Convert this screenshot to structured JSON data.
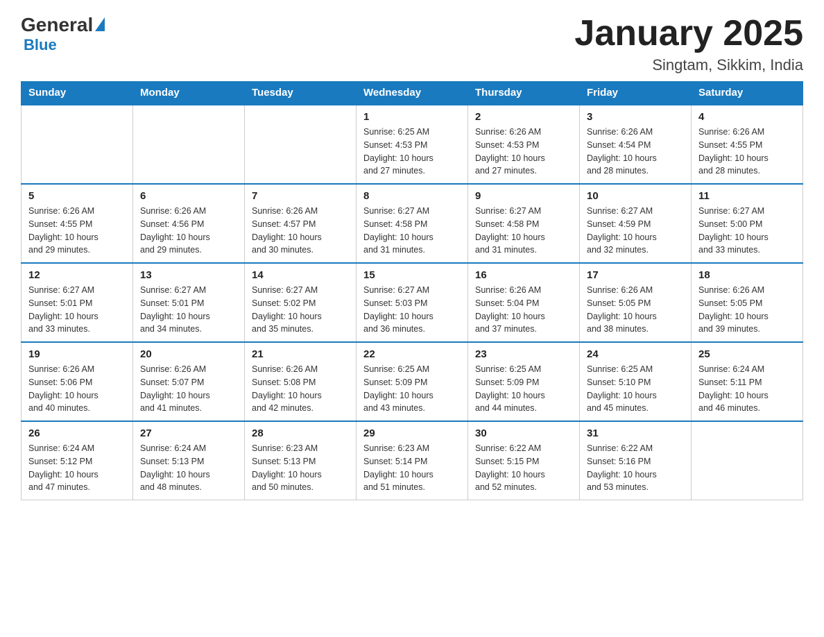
{
  "header": {
    "logo_general": "General",
    "logo_blue": "Blue",
    "month_title": "January 2025",
    "location": "Singtam, Sikkim, India"
  },
  "weekdays": [
    "Sunday",
    "Monday",
    "Tuesday",
    "Wednesday",
    "Thursday",
    "Friday",
    "Saturday"
  ],
  "weeks": [
    [
      {
        "day": "",
        "info": ""
      },
      {
        "day": "",
        "info": ""
      },
      {
        "day": "",
        "info": ""
      },
      {
        "day": "1",
        "info": "Sunrise: 6:25 AM\nSunset: 4:53 PM\nDaylight: 10 hours\nand 27 minutes."
      },
      {
        "day": "2",
        "info": "Sunrise: 6:26 AM\nSunset: 4:53 PM\nDaylight: 10 hours\nand 27 minutes."
      },
      {
        "day": "3",
        "info": "Sunrise: 6:26 AM\nSunset: 4:54 PM\nDaylight: 10 hours\nand 28 minutes."
      },
      {
        "day": "4",
        "info": "Sunrise: 6:26 AM\nSunset: 4:55 PM\nDaylight: 10 hours\nand 28 minutes."
      }
    ],
    [
      {
        "day": "5",
        "info": "Sunrise: 6:26 AM\nSunset: 4:55 PM\nDaylight: 10 hours\nand 29 minutes."
      },
      {
        "day": "6",
        "info": "Sunrise: 6:26 AM\nSunset: 4:56 PM\nDaylight: 10 hours\nand 29 minutes."
      },
      {
        "day": "7",
        "info": "Sunrise: 6:26 AM\nSunset: 4:57 PM\nDaylight: 10 hours\nand 30 minutes."
      },
      {
        "day": "8",
        "info": "Sunrise: 6:27 AM\nSunset: 4:58 PM\nDaylight: 10 hours\nand 31 minutes."
      },
      {
        "day": "9",
        "info": "Sunrise: 6:27 AM\nSunset: 4:58 PM\nDaylight: 10 hours\nand 31 minutes."
      },
      {
        "day": "10",
        "info": "Sunrise: 6:27 AM\nSunset: 4:59 PM\nDaylight: 10 hours\nand 32 minutes."
      },
      {
        "day": "11",
        "info": "Sunrise: 6:27 AM\nSunset: 5:00 PM\nDaylight: 10 hours\nand 33 minutes."
      }
    ],
    [
      {
        "day": "12",
        "info": "Sunrise: 6:27 AM\nSunset: 5:01 PM\nDaylight: 10 hours\nand 33 minutes."
      },
      {
        "day": "13",
        "info": "Sunrise: 6:27 AM\nSunset: 5:01 PM\nDaylight: 10 hours\nand 34 minutes."
      },
      {
        "day": "14",
        "info": "Sunrise: 6:27 AM\nSunset: 5:02 PM\nDaylight: 10 hours\nand 35 minutes."
      },
      {
        "day": "15",
        "info": "Sunrise: 6:27 AM\nSunset: 5:03 PM\nDaylight: 10 hours\nand 36 minutes."
      },
      {
        "day": "16",
        "info": "Sunrise: 6:26 AM\nSunset: 5:04 PM\nDaylight: 10 hours\nand 37 minutes."
      },
      {
        "day": "17",
        "info": "Sunrise: 6:26 AM\nSunset: 5:05 PM\nDaylight: 10 hours\nand 38 minutes."
      },
      {
        "day": "18",
        "info": "Sunrise: 6:26 AM\nSunset: 5:05 PM\nDaylight: 10 hours\nand 39 minutes."
      }
    ],
    [
      {
        "day": "19",
        "info": "Sunrise: 6:26 AM\nSunset: 5:06 PM\nDaylight: 10 hours\nand 40 minutes."
      },
      {
        "day": "20",
        "info": "Sunrise: 6:26 AM\nSunset: 5:07 PM\nDaylight: 10 hours\nand 41 minutes."
      },
      {
        "day": "21",
        "info": "Sunrise: 6:26 AM\nSunset: 5:08 PM\nDaylight: 10 hours\nand 42 minutes."
      },
      {
        "day": "22",
        "info": "Sunrise: 6:25 AM\nSunset: 5:09 PM\nDaylight: 10 hours\nand 43 minutes."
      },
      {
        "day": "23",
        "info": "Sunrise: 6:25 AM\nSunset: 5:09 PM\nDaylight: 10 hours\nand 44 minutes."
      },
      {
        "day": "24",
        "info": "Sunrise: 6:25 AM\nSunset: 5:10 PM\nDaylight: 10 hours\nand 45 minutes."
      },
      {
        "day": "25",
        "info": "Sunrise: 6:24 AM\nSunset: 5:11 PM\nDaylight: 10 hours\nand 46 minutes."
      }
    ],
    [
      {
        "day": "26",
        "info": "Sunrise: 6:24 AM\nSunset: 5:12 PM\nDaylight: 10 hours\nand 47 minutes."
      },
      {
        "day": "27",
        "info": "Sunrise: 6:24 AM\nSunset: 5:13 PM\nDaylight: 10 hours\nand 48 minutes."
      },
      {
        "day": "28",
        "info": "Sunrise: 6:23 AM\nSunset: 5:13 PM\nDaylight: 10 hours\nand 50 minutes."
      },
      {
        "day": "29",
        "info": "Sunrise: 6:23 AM\nSunset: 5:14 PM\nDaylight: 10 hours\nand 51 minutes."
      },
      {
        "day": "30",
        "info": "Sunrise: 6:22 AM\nSunset: 5:15 PM\nDaylight: 10 hours\nand 52 minutes."
      },
      {
        "day": "31",
        "info": "Sunrise: 6:22 AM\nSunset: 5:16 PM\nDaylight: 10 hours\nand 53 minutes."
      },
      {
        "day": "",
        "info": ""
      }
    ]
  ]
}
